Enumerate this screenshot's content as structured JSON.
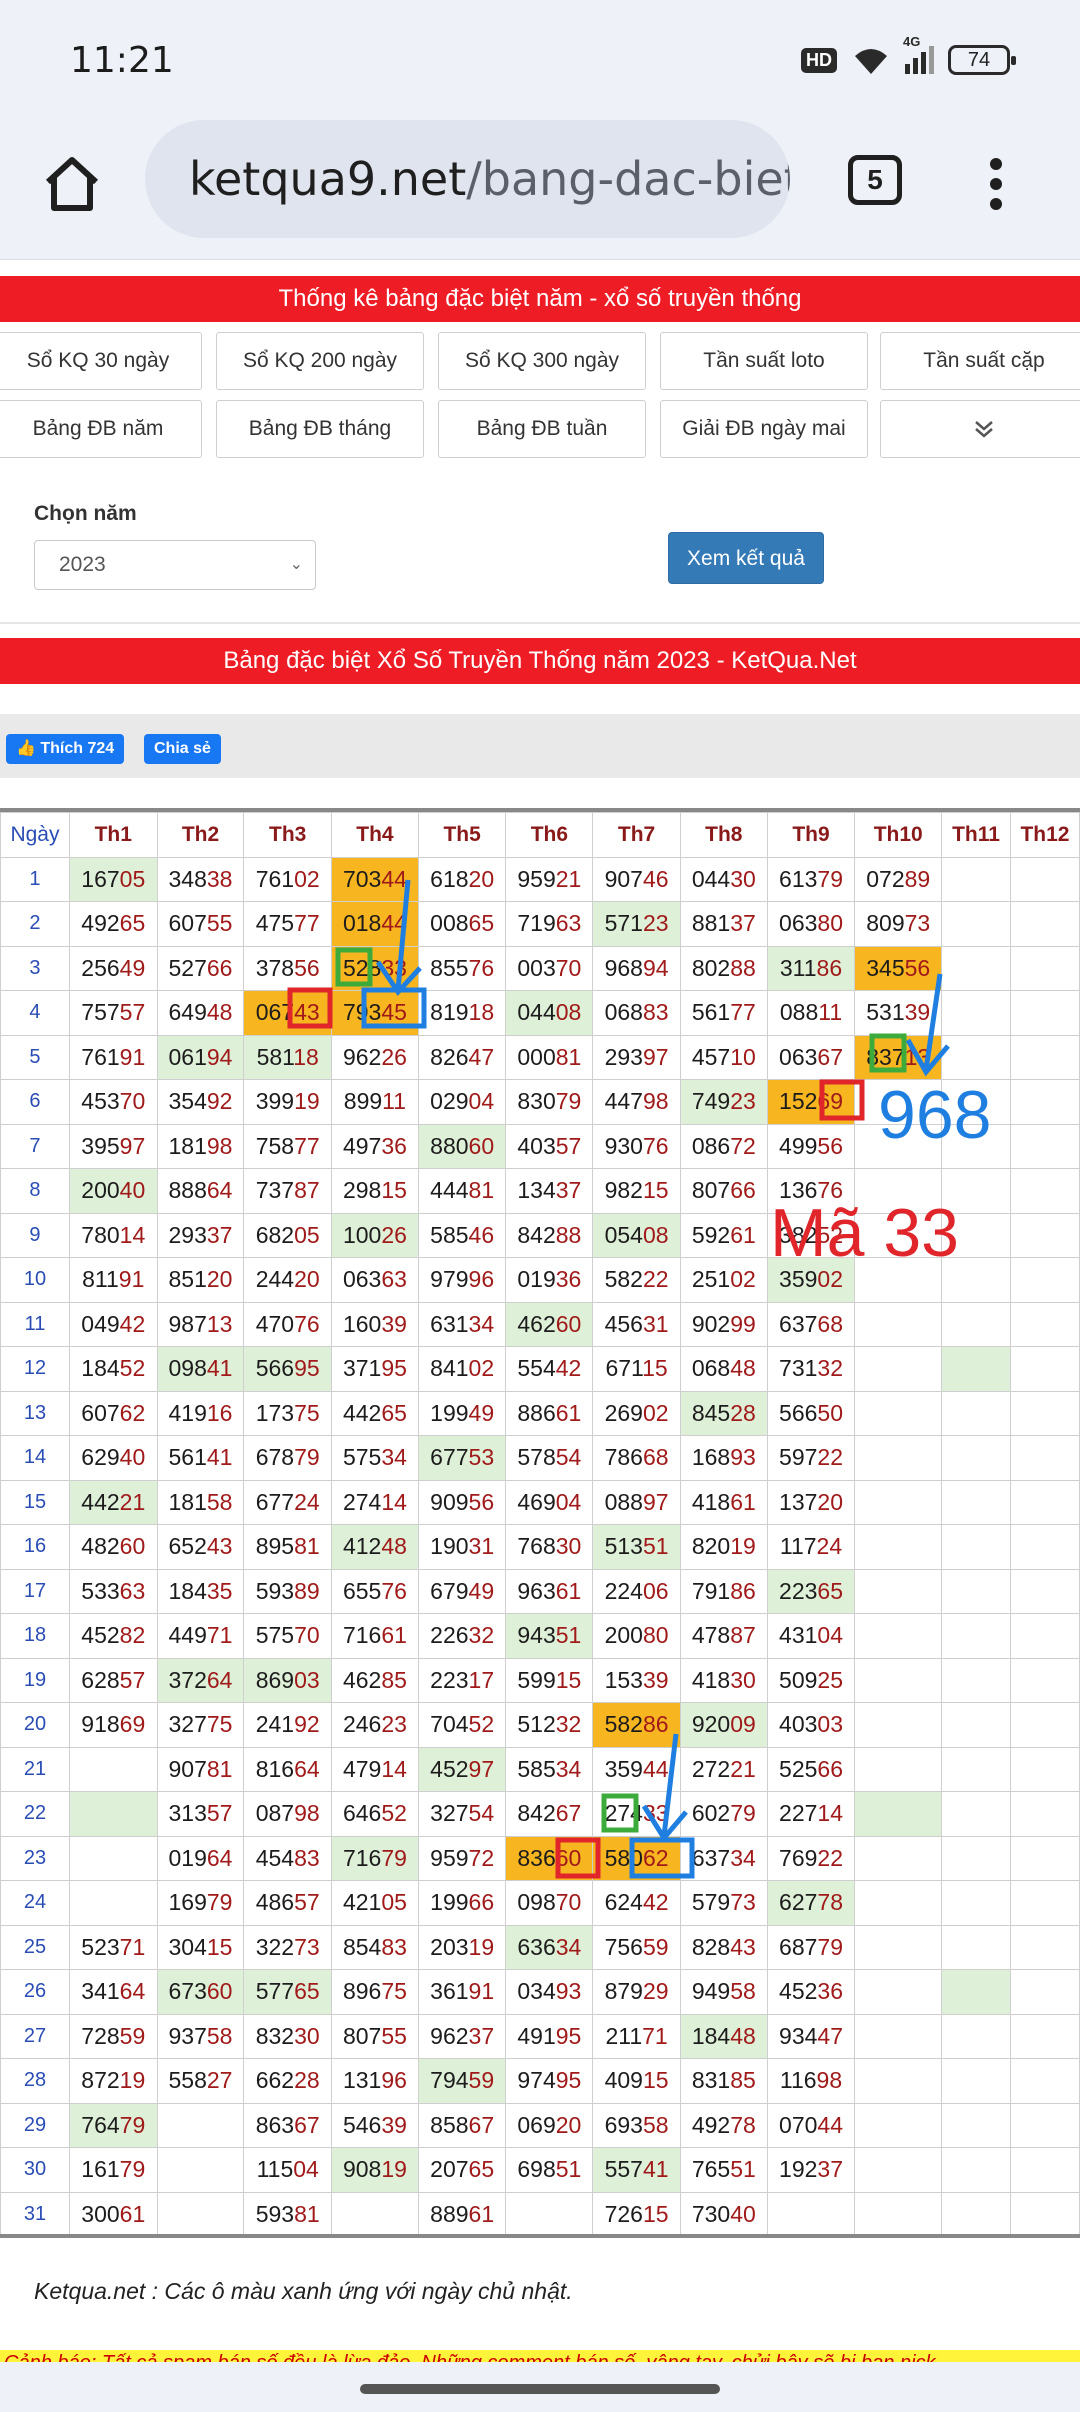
{
  "status": {
    "time": "11:21",
    "hd": "HD",
    "network": "4G",
    "battery": "74"
  },
  "browser": {
    "url_host": "ketqua9.net",
    "url_path": "/bang-dac-biet-nam",
    "tab_count": "5"
  },
  "page": {
    "top_banner": "Thống kê bảng đặc biệt năm - xổ số truyền thống",
    "nav_row1": [
      "Sổ KQ 30 ngày",
      "Sổ KQ 200 ngày",
      "Sổ KQ 300 ngày",
      "Tần suất loto",
      "Tần suất cặp"
    ],
    "nav_row2": [
      "Bảng ĐB năm",
      "Bảng ĐB tháng",
      "Bảng ĐB tuần",
      "Giải ĐB ngày mai"
    ],
    "year_label": "Chọn năm",
    "year_value": "2023",
    "view_button": "Xem kết quả",
    "table_banner": "Bảng đặc biệt Xổ Số Truyền Thống năm 2023 - KetQua.Net",
    "like_label": "Thích 724",
    "share_label": "Chia sẻ",
    "note": "Ketqua.net : Các ô màu xanh ứng với ngày chủ nhật.",
    "warning": "Cảnh báo: Tất cả spam bán số đều là lừa đảo. Những comment bán số, vâng tay, chửi bậy sẽ bị ban nick"
  },
  "table": {
    "headers": [
      "Ngày",
      "Th1",
      "Th2",
      "Th3",
      "Th4",
      "Th5",
      "Th6",
      "Th7",
      "Th8",
      "Th9",
      "Th10",
      "Th11",
      "Th12"
    ],
    "rows": [
      [
        "1",
        "16705",
        "34838",
        "76102",
        "70344",
        "61820",
        "95921",
        "90746",
        "04430",
        "61379",
        "07289",
        "",
        ""
      ],
      [
        "2",
        "49265",
        "60755",
        "47577",
        "01844",
        "00865",
        "71963",
        "57123",
        "88137",
        "06380",
        "80973",
        "",
        ""
      ],
      [
        "3",
        "25649",
        "52766",
        "37856",
        "52833",
        "85576",
        "00370",
        "96894",
        "80288",
        "31186",
        "34556",
        "",
        ""
      ],
      [
        "4",
        "75757",
        "64948",
        "06743",
        "79345",
        "81918",
        "04408",
        "06883",
        "56177",
        "08811",
        "53139",
        "",
        ""
      ],
      [
        "5",
        "76191",
        "06194",
        "58118",
        "96226",
        "82647",
        "00081",
        "29397",
        "45710",
        "06367",
        "83713",
        "",
        ""
      ],
      [
        "6",
        "45370",
        "35492",
        "39919",
        "89911",
        "02904",
        "83079",
        "44798",
        "74923",
        "15269",
        "",
        "",
        ""
      ],
      [
        "7",
        "39597",
        "18198",
        "75877",
        "49736",
        "88060",
        "40357",
        "93076",
        "08672",
        "49956",
        "",
        "",
        ""
      ],
      [
        "8",
        "20040",
        "88864",
        "73787",
        "29815",
        "44481",
        "13437",
        "98215",
        "80766",
        "13676",
        "",
        "",
        ""
      ],
      [
        "9",
        "78014",
        "29337",
        "68205",
        "10026",
        "58546",
        "84288",
        "05408",
        "59261",
        "38252",
        "",
        "",
        ""
      ],
      [
        "10",
        "81191",
        "85120",
        "24420",
        "06363",
        "97996",
        "01936",
        "58222",
        "25102",
        "35902",
        "",
        "",
        ""
      ],
      [
        "11",
        "04942",
        "98713",
        "47076",
        "16039",
        "63134",
        "46260",
        "45631",
        "90299",
        "63768",
        "",
        "",
        ""
      ],
      [
        "12",
        "18452",
        "09841",
        "56695",
        "37195",
        "84102",
        "55442",
        "67115",
        "06848",
        "73132",
        "",
        "",
        ""
      ],
      [
        "13",
        "60762",
        "41916",
        "17375",
        "44265",
        "19949",
        "88661",
        "26902",
        "84528",
        "56650",
        "",
        "",
        ""
      ],
      [
        "14",
        "62940",
        "56141",
        "67879",
        "57534",
        "67753",
        "57854",
        "78668",
        "16893",
        "59722",
        "",
        "",
        ""
      ],
      [
        "15",
        "44221",
        "18158",
        "67724",
        "27414",
        "90956",
        "46904",
        "08897",
        "41861",
        "13720",
        "",
        "",
        ""
      ],
      [
        "16",
        "48260",
        "65243",
        "89581",
        "41248",
        "19031",
        "76830",
        "51351",
        "82019",
        "11724",
        "",
        "",
        ""
      ],
      [
        "17",
        "53363",
        "18435",
        "59389",
        "65576",
        "67949",
        "96361",
        "22406",
        "79186",
        "22365",
        "",
        "",
        ""
      ],
      [
        "18",
        "45282",
        "44971",
        "57570",
        "71661",
        "22632",
        "94351",
        "20080",
        "47887",
        "43104",
        "",
        "",
        ""
      ],
      [
        "19",
        "62857",
        "37264",
        "86903",
        "46285",
        "22317",
        "59915",
        "15339",
        "41830",
        "50925",
        "",
        "",
        ""
      ],
      [
        "20",
        "91869",
        "32775",
        "24192",
        "24623",
        "70452",
        "51232",
        "58286",
        "92009",
        "40303",
        "",
        "",
        ""
      ],
      [
        "21",
        "",
        "90781",
        "81664",
        "47914",
        "45297",
        "58534",
        "35944",
        "27221",
        "52566",
        "",
        "",
        ""
      ],
      [
        "22",
        "",
        "31357",
        "08798",
        "64652",
        "32754",
        "84267",
        "27433",
        "60279",
        "22714",
        "",
        "",
        ""
      ],
      [
        "23",
        "",
        "01964",
        "45483",
        "71679",
        "95972",
        "83660",
        "58062",
        "63734",
        "76922",
        "",
        "",
        ""
      ],
      [
        "24",
        "",
        "16979",
        "48657",
        "42105",
        "19966",
        "09870",
        "62442",
        "57973",
        "62778",
        "",
        "",
        ""
      ],
      [
        "25",
        "52371",
        "30415",
        "32273",
        "85483",
        "20319",
        "63634",
        "75659",
        "82843",
        "68779",
        "",
        "",
        ""
      ],
      [
        "26",
        "34164",
        "67360",
        "57765",
        "89675",
        "36191",
        "03493",
        "87929",
        "94958",
        "45236",
        "",
        "",
        ""
      ],
      [
        "27",
        "72859",
        "93758",
        "83230",
        "80755",
        "96237",
        "49195",
        "21171",
        "18448",
        "93447",
        "",
        "",
        ""
      ],
      [
        "28",
        "87219",
        "55827",
        "66228",
        "13196",
        "79459",
        "97495",
        "40915",
        "83185",
        "11698",
        "",
        "",
        ""
      ],
      [
        "29",
        "76479",
        "",
        "86367",
        "54639",
        "85867",
        "06920",
        "69358",
        "49278",
        "07044",
        "",
        "",
        ""
      ],
      [
        "30",
        "16179",
        "",
        "11504",
        "90819",
        "20765",
        "69851",
        "55741",
        "76551",
        "19237",
        "",
        "",
        ""
      ],
      [
        "31",
        "30061",
        "",
        "59381",
        "",
        "88961",
        "",
        "72615",
        "73040",
        "",
        "",
        "",
        ""
      ]
    ]
  },
  "annotations": {
    "big_number": "968",
    "code_label": "Mã 33"
  },
  "colors": {
    "red_banner": "#ee1c25",
    "sunday_green": "#dff0d8",
    "highlight_orange": "#f7b520",
    "blue_button": "#337ab7",
    "annot_blue": "#1f7fe0",
    "annot_red": "#e0262a"
  }
}
